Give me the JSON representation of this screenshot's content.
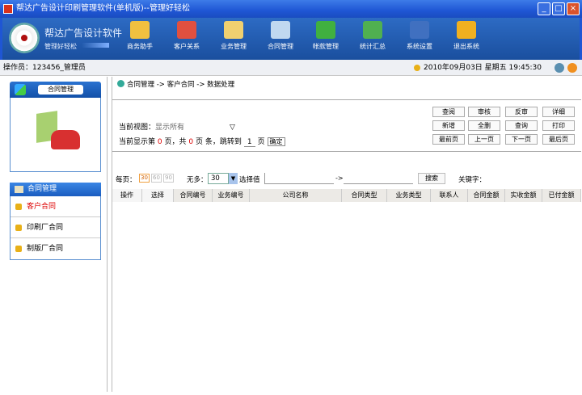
{
  "window": {
    "title": "帮达广告设计印刷管理软件(单机版)--管理好轻松",
    "min": "_",
    "max": "□",
    "close": "×"
  },
  "brand": {
    "name": "帮达广告设计软件",
    "slogan": "管理好轻松"
  },
  "toolbar": [
    {
      "label": "商务助手",
      "color": "#f0c040"
    },
    {
      "label": "客户关系",
      "color": "#e05040"
    },
    {
      "label": "业务管理",
      "color": "#f0d070"
    },
    {
      "label": "合同管理",
      "color": "#c0d8f0"
    },
    {
      "label": "帐款管理",
      "color": "#40b040"
    },
    {
      "label": "统计汇总",
      "color": "#50b050"
    },
    {
      "label": "系统设置",
      "color": "#4070c0"
    },
    {
      "label": "退出系统",
      "color": "#f0b020"
    }
  ],
  "status": {
    "operator": "操作员：123456_管理员",
    "datetime": "2010年09月03日 星期五 19:45:30"
  },
  "sidebar": {
    "panel_title": "合同管理",
    "menu_title": "合同管理",
    "items": [
      "客户合同",
      "印刷厂合同",
      "制版厂合同"
    ]
  },
  "main": {
    "breadcrumb": "合同管理 -> 客户合同 -> 数据处理",
    "view_label": "当前视图：",
    "view_value": "显示所有",
    "page_prefix": "当前显示第",
    "page_cur": "0",
    "page_mid": "页，共",
    "page_total": "0",
    "page_suffix": "页 条，跳转到",
    "jump_value": "1",
    "jump_unit": "页",
    "confirm": "确定",
    "buttons": [
      [
        "查阅",
        "审核",
        "反审",
        "详细"
      ],
      [
        "新增",
        "全删",
        "查询",
        "打印"
      ],
      [
        "最前页",
        "上一页",
        "下一页",
        "最后页"
      ]
    ],
    "per_page_label": "每页：",
    "per_page_options": [
      "30",
      "60",
      "90"
    ],
    "count_label": "无多：",
    "count_value": "30",
    "select_label": "选择值",
    "arrow": "->",
    "search": "搜索",
    "keyword_label": "关键字：",
    "columns": [
      "操作",
      "选择",
      "合同编号",
      "业务编号",
      "公司名称",
      "合同类型",
      "业务类型",
      "联系人",
      "合同金额",
      "实收金额",
      "已付金额"
    ]
  }
}
